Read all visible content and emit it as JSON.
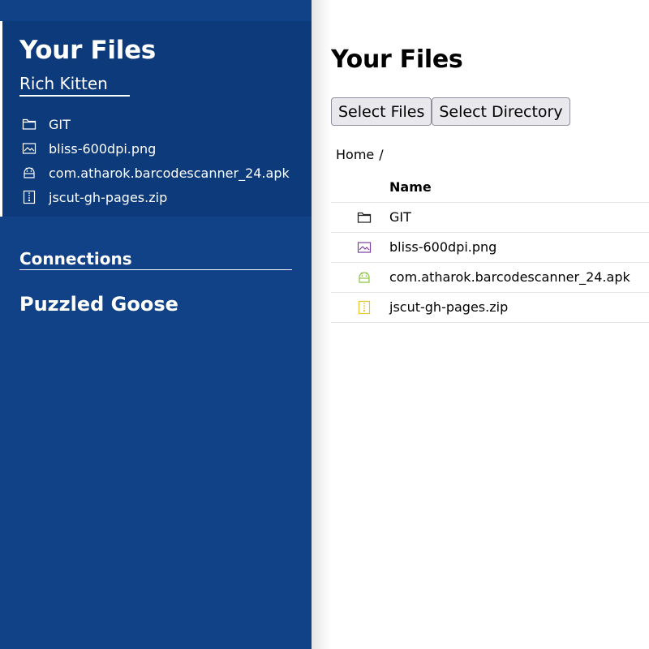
{
  "sidebar": {
    "title": "Your Files",
    "user": "Rich Kitten",
    "files": [
      {
        "name": "GIT",
        "icon": "folder-icon"
      },
      {
        "name": "bliss-600dpi.png",
        "icon": "image-icon"
      },
      {
        "name": "com.atharok.barcodescanner_24.apk",
        "icon": "android-icon"
      },
      {
        "name": "jscut-gh-pages.zip",
        "icon": "zip-icon"
      }
    ],
    "connections_heading": "Connections",
    "connections": [
      {
        "name": "Puzzled Goose"
      }
    ]
  },
  "main": {
    "title": "Your Files",
    "select_files_label": "Select Files",
    "select_directory_label": "Select Directory",
    "breadcrumb": {
      "home": "Home",
      "separator": "/"
    },
    "table": {
      "name_header": "Name",
      "rows": [
        {
          "name": "GIT",
          "icon": "folder-icon",
          "icon_color": "#222222"
        },
        {
          "name": "bliss-600dpi.png",
          "icon": "image-icon",
          "icon_color": "#7b3fa0"
        },
        {
          "name": "com.atharok.barcodescanner_24.apk",
          "icon": "android-icon",
          "icon_color": "#8bc53f"
        },
        {
          "name": "jscut-gh-pages.zip",
          "icon": "zip-icon",
          "icon_color": "#e6c533"
        }
      ]
    }
  },
  "colors": {
    "sidebar_bg": "#114287",
    "sidebar_files_bg": "#0d3a7a",
    "text_light": "#ffffff"
  }
}
